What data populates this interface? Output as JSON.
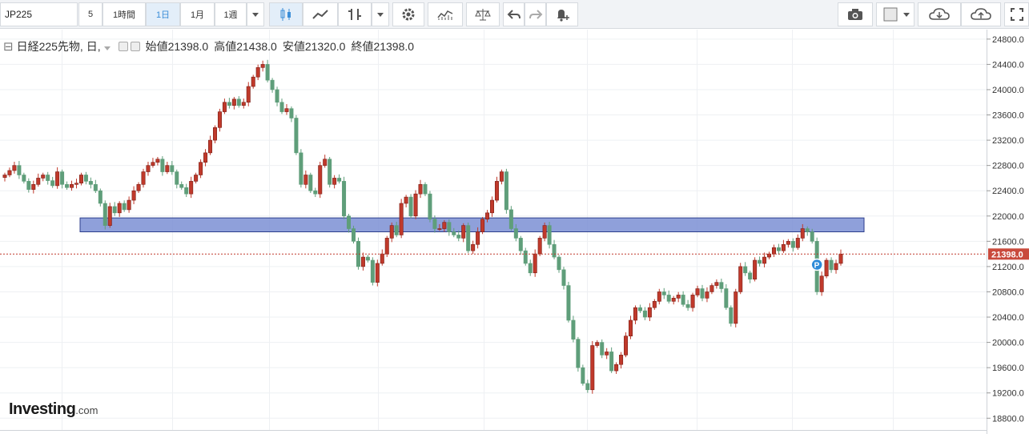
{
  "toolbar": {
    "symbol": "JP225",
    "intervals": [
      "5",
      "1時間",
      "1日",
      "1月",
      "1週"
    ],
    "active_interval": "1日",
    "icons": [
      "candles-icon",
      "line-chart-icon",
      "indicators-icon",
      "caret-down-icon",
      "settings-icon",
      "studies-icon",
      "compare-icon",
      "undo-icon",
      "redo-icon",
      "alert-icon",
      "camera-icon",
      "color-icon",
      "cloud-download-icon",
      "cloud-upload-icon",
      "fullscreen-icon"
    ]
  },
  "legend": {
    "collapse_symbol": "⊟",
    "title": "日経225先物, 日,",
    "open_label": "始値",
    "open": "21398.0",
    "high_label": "高値",
    "high": "21438.0",
    "low_label": "安値",
    "low": "21320.0",
    "close_label": "終値",
    "close": "21398.0"
  },
  "logo": {
    "name": "Investing",
    "suffix": ".com"
  },
  "colors": {
    "up": "#c0392b",
    "down": "#5f9e7a",
    "zone": "#7b8fd4",
    "price_line": "#c0392b",
    "price_tag": "#c94a3c"
  },
  "chart_data": {
    "type": "candlestick",
    "ylim": [
      18550,
      24950
    ],
    "yticks": [
      "24800.0",
      "24400.0",
      "24000.0",
      "23600.0",
      "23200.0",
      "22800.0",
      "22400.0",
      "22000.0",
      "21600.0",
      "21200.0",
      "20800.0",
      "20400.0",
      "20000.0",
      "19600.0",
      "19200.0",
      "18800.0"
    ],
    "current_price": "21398.0",
    "support_zone": [
      21750,
      21970
    ],
    "marker": "P",
    "closes": [
      22650,
      22720,
      22800,
      22650,
      22550,
      22420,
      22500,
      22600,
      22650,
      22560,
      22480,
      22700,
      22500,
      22450,
      22500,
      22520,
      22650,
      22550,
      22500,
      22400,
      22200,
      21850,
      22150,
      22050,
      22200,
      22100,
      22250,
      22400,
      22500,
      22700,
      22800,
      22850,
      22900,
      22700,
      22800,
      22700,
      22500,
      22450,
      22350,
      22550,
      22650,
      22850,
      23000,
      23200,
      23400,
      23650,
      23800,
      23750,
      23850,
      23750,
      23800,
      24050,
      24200,
      24350,
      24400,
      24150,
      24000,
      23800,
      23650,
      23700,
      23550,
      23000,
      22500,
      22650,
      22400,
      22350,
      22800,
      22900,
      22500,
      22600,
      22550,
      22000,
      21800,
      21600,
      21200,
      21350,
      21300,
      20950,
      21250,
      21400,
      21650,
      21850,
      21700,
      22200,
      22300,
      22000,
      22350,
      22500,
      22350,
      21950,
      21800,
      21800,
      21900,
      21750,
      21700,
      21650,
      21850,
      21450,
      21550,
      21750,
      21950,
      22050,
      22250,
      22550,
      22700,
      22100,
      21800,
      21650,
      21450,
      21250,
      21100,
      21400,
      21650,
      21850,
      21550,
      21350,
      21150,
      20900,
      20350,
      20050,
      19600,
      19350,
      19250,
      19950,
      20000,
      19800,
      19850,
      19550,
      19650,
      19800,
      20100,
      20350,
      20550,
      20500,
      20400,
      20550,
      20650,
      20800,
      20750,
      20650,
      20700,
      20750,
      20600,
      20550,
      20750,
      20850,
      20700,
      20800,
      20900,
      20950,
      20850,
      20550,
      20300,
      20800,
      21200,
      21100,
      21000,
      21300,
      21250,
      21350,
      21400,
      21500,
      21450,
      21550,
      21600,
      21500,
      21650,
      21800,
      21750,
      21600,
      20800,
      21050,
      21300,
      21150,
      21250,
      21398
    ]
  }
}
